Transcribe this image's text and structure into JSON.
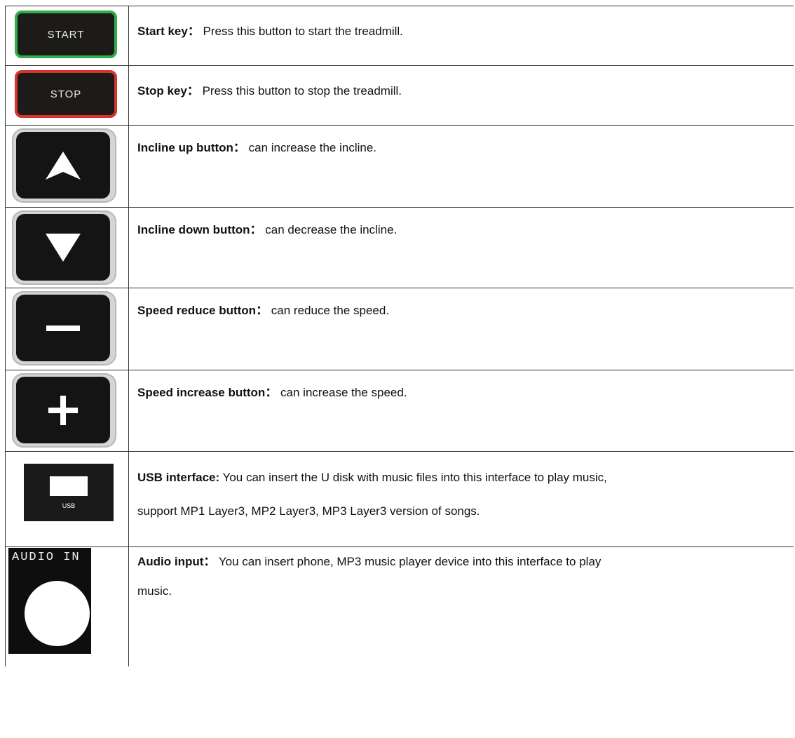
{
  "rows": [
    {
      "label": "Start key：",
      "text": " Press this button to start the treadmill.",
      "icon": "START"
    },
    {
      "label": "Stop key：",
      "text": " Press this button to stop the treadmill.",
      "icon": "STOP"
    },
    {
      "label": "Incline up button：",
      "text": " can increase the incline.",
      "icon": "up-arrow-icon"
    },
    {
      "label": "Incline down button：",
      "text": " can decrease the incline.",
      "icon": "down-arrow-icon"
    },
    {
      "label": "Speed reduce button：",
      "text": " can reduce the speed.",
      "icon": "minus-icon"
    },
    {
      "label": "Speed increase button：",
      "text": " can increase the speed.",
      "icon": "plus-icon"
    },
    {
      "label": "USB interface:",
      "text": " You can insert the U disk with music files into this interface to play music,",
      "text2": "support MP1 Layer3, MP2 Layer3, MP3 Layer3 version of songs.",
      "icon": "USB"
    },
    {
      "label": "Audio input：",
      "text": " You can insert phone, MP3 music player device into this interface to play",
      "text2": "music.",
      "icon": "AUDIO IN"
    }
  ],
  "colors": {
    "start_border": "#2fae4a",
    "stop_border": "#d8332d",
    "key_bg": "#1c1b1a"
  }
}
